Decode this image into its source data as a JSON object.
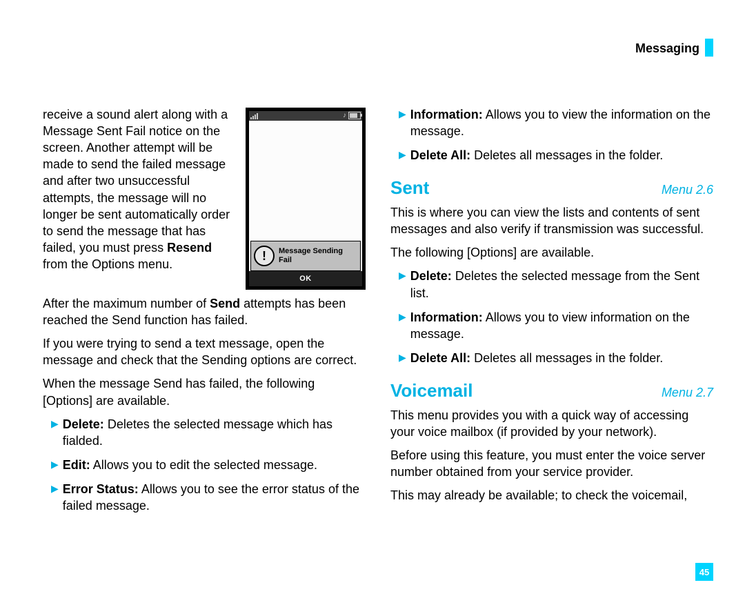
{
  "header": {
    "title": "Messaging"
  },
  "left": {
    "intro": "receive a sound alert along with a Message Sent Fail notice on the screen. Another attempt will be made to send the failed message and after two unsuccessful attempts, the message will no longer be sent automatically order to send the message that has failed, you must press ",
    "resend_bold": "Resend",
    "intro_tail": " from the Options menu.",
    "p2a": "After the maximum number of ",
    "p2_bold": "Send",
    "p2b": " attempts has been reached the Send function has failed.",
    "p3": "If you were trying to send a text message, open the message and check that the Sending options are correct.",
    "p4": "When the message Send has failed, the following [Options] are available.",
    "items": [
      {
        "bold": "Delete:",
        "rest": " Deletes the selected message which has fialded."
      },
      {
        "bold": "Edit:",
        "rest": " Allows you to edit the selected message."
      },
      {
        "bold": "Error Status:",
        "rest": " Allows you to see the error status of the failed message."
      }
    ],
    "phone": {
      "popup_line1": "Message Sending",
      "popup_line2": "Fail",
      "ok": "OK"
    }
  },
  "right": {
    "top_items": [
      {
        "bold": "Information:",
        "rest": " Allows you to view the information on the message."
      },
      {
        "bold": "Delete All:",
        "rest": " Deletes all messages in the folder."
      }
    ],
    "sent": {
      "title": "Sent",
      "menu": "Menu 2.6",
      "p1": "This is where you can view the lists and contents of sent messages and also verify if transmission was successful.",
      "p2": "The following [Options] are available.",
      "items": [
        {
          "bold": "Delete:",
          "rest": " Deletes the selected message from the Sent list."
        },
        {
          "bold": "Information:",
          "rest": " Allows you to view information on the message."
        },
        {
          "bold": "Delete All:",
          "rest": " Deletes all messages in the folder."
        }
      ]
    },
    "voicemail": {
      "title": "Voicemail",
      "menu": "Menu 2.7",
      "p1": "This menu provides you with a quick way of accessing your voice mailbox (if provided by your network).",
      "p2": "Before using this feature, you must enter the voice server number obtained from your service provider.",
      "p3": "This may already be available; to check the voicemail,"
    }
  },
  "page_number": "45"
}
